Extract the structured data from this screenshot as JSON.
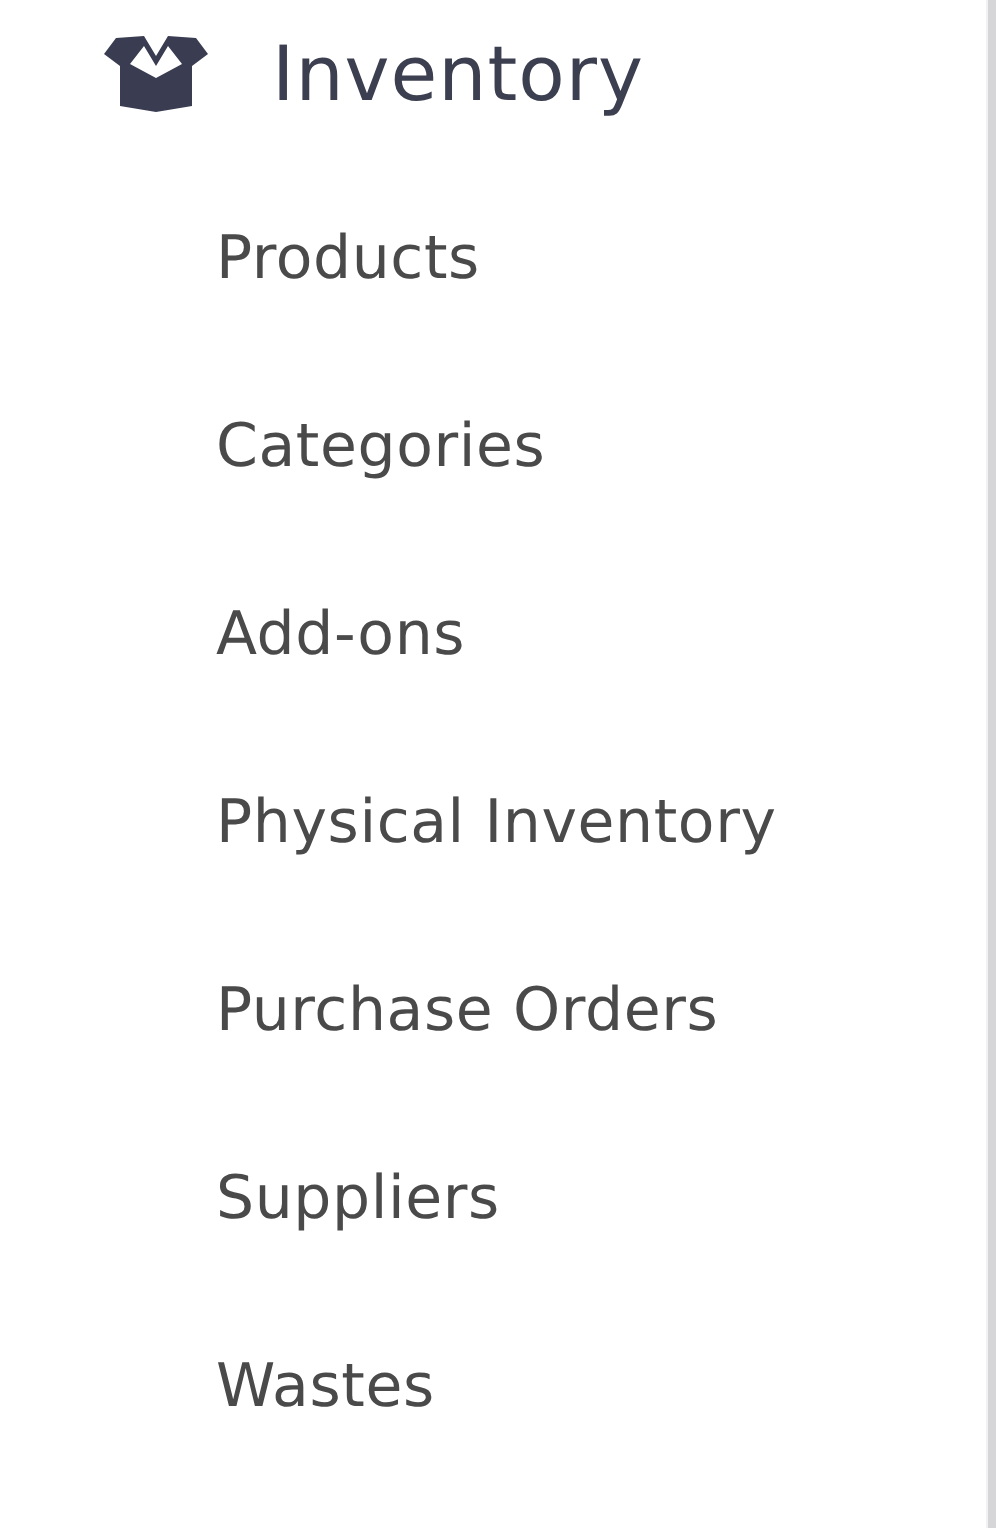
{
  "section": {
    "title": "Inventory",
    "expanded": true
  },
  "items": [
    {
      "label": "Products"
    },
    {
      "label": "Categories"
    },
    {
      "label": "Add-ons"
    },
    {
      "label": "Physical Inventory"
    },
    {
      "label": "Purchase Orders"
    },
    {
      "label": "Suppliers"
    },
    {
      "label": "Wastes"
    }
  ]
}
